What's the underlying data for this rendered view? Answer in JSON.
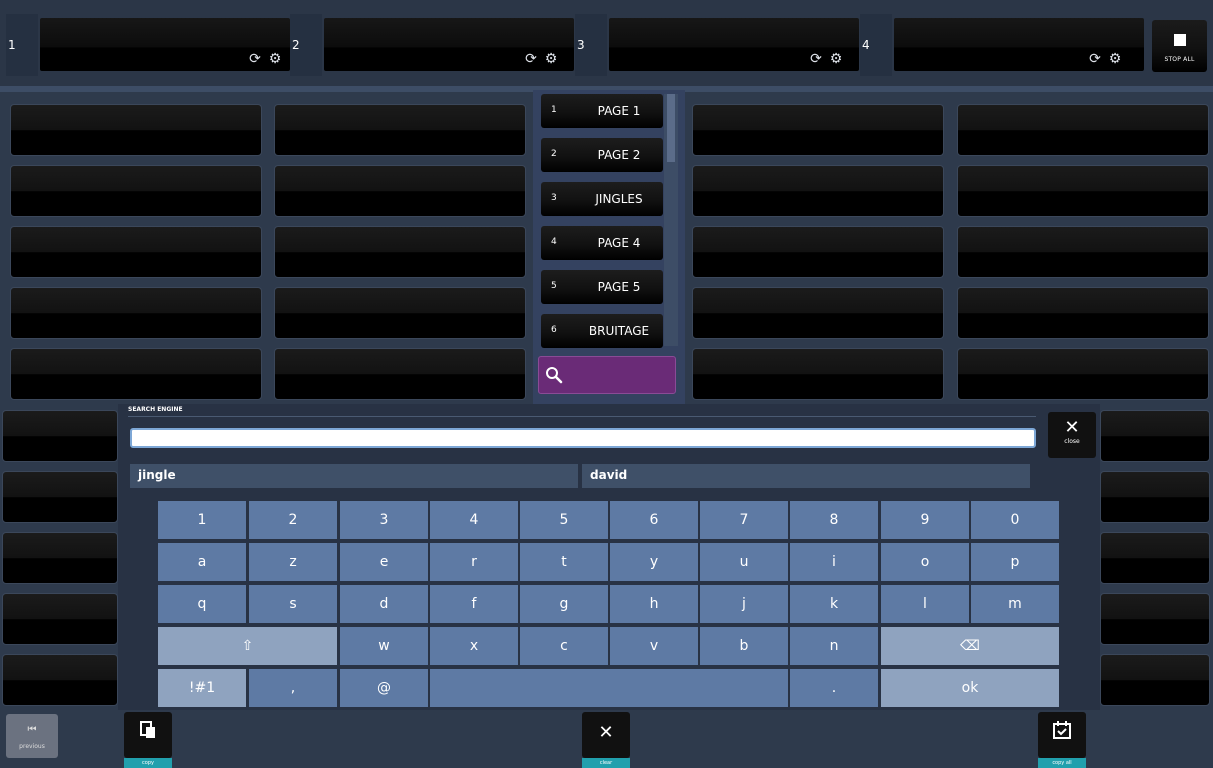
{
  "players": [
    {
      "number": "1"
    },
    {
      "number": "2"
    },
    {
      "number": "3"
    },
    {
      "number": "4"
    }
  ],
  "icons": {
    "reload": "refresh-icon",
    "settings": "gear-icon",
    "stop": "stop-icon",
    "search": "search-icon"
  },
  "stop_all": {
    "label": "STOP ALL"
  },
  "pages": [
    {
      "num": "1",
      "label": "PAGE 1"
    },
    {
      "num": "2",
      "label": "PAGE 2"
    },
    {
      "num": "3",
      "label": "JINGLES"
    },
    {
      "num": "4",
      "label": "PAGE 4"
    },
    {
      "num": "5",
      "label": "PAGE 5"
    },
    {
      "num": "6",
      "label": "BRUITAGE"
    }
  ],
  "search_panel": {
    "title": "SEARCH ENGINE",
    "input_value": "",
    "close_label": "close",
    "suggestions": [
      "jingle",
      "david"
    ]
  },
  "keyboard": {
    "row1": [
      "1",
      "2",
      "3",
      "4",
      "5",
      "6",
      "7",
      "8",
      "9",
      "0"
    ],
    "row2": [
      "a",
      "z",
      "e",
      "r",
      "t",
      "y",
      "u",
      "i",
      "o",
      "p"
    ],
    "row3": [
      "q",
      "s",
      "d",
      "f",
      "g",
      "h",
      "j",
      "k",
      "l",
      "m"
    ],
    "row4": [
      "⇧",
      "w",
      "x",
      "c",
      "v",
      "b",
      "n",
      "⌫"
    ],
    "row5": [
      "!#1",
      ",",
      "@",
      "",
      ".",
      "ok"
    ]
  },
  "bottom": {
    "previous": "previous",
    "copy": "copy",
    "clear": "clear",
    "copy_all": "copy all"
  },
  "colors": {
    "accent_search": "#6a2b77",
    "key_blue": "#5e7aa4",
    "key_light": "#8fa3bf",
    "teal_label": "#21a0ad"
  }
}
